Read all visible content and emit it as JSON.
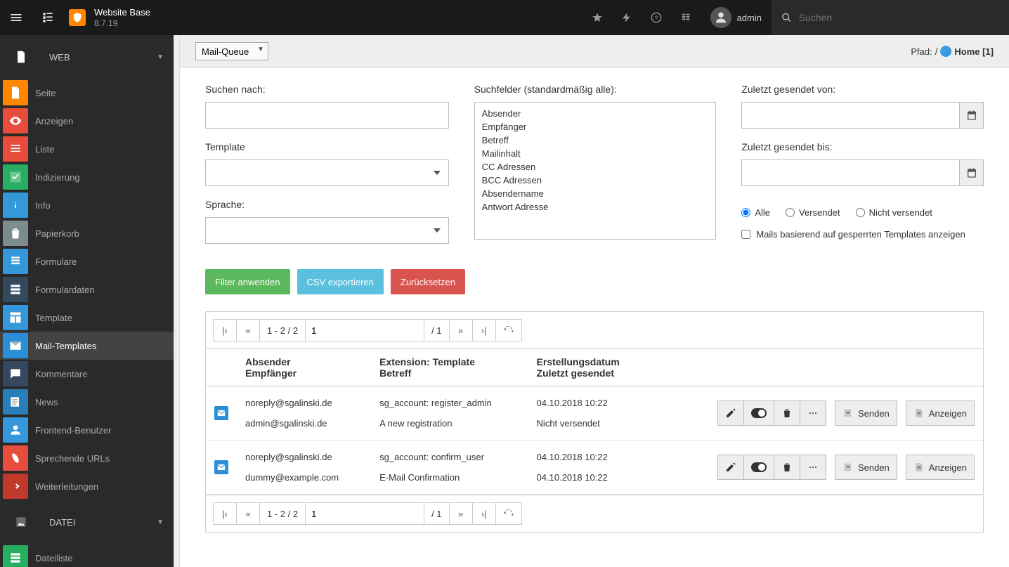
{
  "topbar": {
    "site_name": "Website Base",
    "version": "8.7.19",
    "username": "admin",
    "search_placeholder": "Suchen"
  },
  "sidebar": {
    "groups": [
      {
        "title": "WEB",
        "items": [
          {
            "id": "seite",
            "label": "Seite",
            "icon": "page",
            "color": "#ff8700"
          },
          {
            "id": "anzeigen",
            "label": "Anzeigen",
            "icon": "eye",
            "color": "#e74c3c"
          },
          {
            "id": "liste",
            "label": "Liste",
            "icon": "list",
            "color": "#e74c3c"
          },
          {
            "id": "indizierung",
            "label": "Indizierung",
            "icon": "check",
            "color": "#27ae60"
          },
          {
            "id": "info",
            "label": "Info",
            "icon": "info",
            "color": "#3498db"
          },
          {
            "id": "papierkorb",
            "label": "Papierkorb",
            "icon": "trash",
            "color": "#7f8c8d"
          },
          {
            "id": "formulare",
            "label": "Formulare",
            "icon": "form",
            "color": "#3498db"
          },
          {
            "id": "formulardaten",
            "label": "Formulardaten",
            "icon": "formdata",
            "color": "#34495e"
          },
          {
            "id": "template",
            "label": "Template",
            "icon": "template",
            "color": "#3498db"
          },
          {
            "id": "mail-templates",
            "label": "Mail-Templates",
            "icon": "mail",
            "color": "#2a8fd8",
            "active": true
          },
          {
            "id": "kommentare",
            "label": "Kommentare",
            "icon": "comment",
            "color": "#34495e"
          },
          {
            "id": "news",
            "label": "News",
            "icon": "news",
            "color": "#2980b9"
          },
          {
            "id": "frontend-benutzer",
            "label": "Frontend-Benutzer",
            "icon": "user",
            "color": "#3498db"
          },
          {
            "id": "sprechende-urls",
            "label": "Sprechende URLs",
            "icon": "url",
            "color": "#e74c3c"
          },
          {
            "id": "weiterleitungen",
            "label": "Weiterleitungen",
            "icon": "redirect",
            "color": "#c0392b"
          }
        ]
      },
      {
        "title": "DATEI",
        "items": [
          {
            "id": "dateiliste",
            "label": "Dateiliste",
            "icon": "filelist",
            "color": "#27ae60"
          }
        ]
      }
    ]
  },
  "doc": {
    "module_select": "Mail-Queue",
    "path_label": "Pfad:",
    "path_sep": "/",
    "path_node": "Home [1]"
  },
  "filter": {
    "search_label": "Suchen nach:",
    "template_label": "Template",
    "language_label": "Sprache:",
    "searchfields_label": "Suchfelder (standardmäßig alle):",
    "searchfields": [
      "Absender",
      "Empfänger",
      "Betreff",
      "Mailinhalt",
      "CC Adressen",
      "BCC Adressen",
      "Absendername",
      "Antwort Adresse"
    ],
    "sent_from_label": "Zuletzt gesendet von:",
    "sent_to_label": "Zuletzt gesendet bis:",
    "radio": {
      "all": "Alle",
      "sent": "Versendet",
      "unsent": "Nicht versendet"
    },
    "radio_selected": "all",
    "locked_label": "Mails basierend auf gesperrten Templates anzeigen",
    "btn_apply": "Filter anwenden",
    "btn_csv": "CSV exportieren",
    "btn_reset": "Zurücksetzen"
  },
  "pagination": {
    "range": "1 - 2 / 2",
    "page_input": "1",
    "total": "/ 1"
  },
  "table": {
    "headers": {
      "sender": "Absender",
      "recipient": "Empfänger",
      "ext": "Extension: Template",
      "subject": "Betreff",
      "created": "Erstellungsdatum",
      "lastsent": "Zuletzt gesendet"
    },
    "rows": [
      {
        "sender": "noreply@sgalinski.de",
        "recipient": "admin@sgalinski.de",
        "ext": "sg_account: register_admin",
        "subject": "A new registration",
        "created": "04.10.2018 10:22",
        "lastsent": "Nicht versendet"
      },
      {
        "sender": "noreply@sgalinski.de",
        "recipient": "dummy@example.com",
        "ext": "sg_account: confirm_user",
        "subject": "E-Mail Confirmation",
        "created": "04.10.2018 10:22",
        "lastsent": "04.10.2018 10:22"
      }
    ],
    "btn_send": "Senden",
    "btn_show": "Anzeigen"
  }
}
